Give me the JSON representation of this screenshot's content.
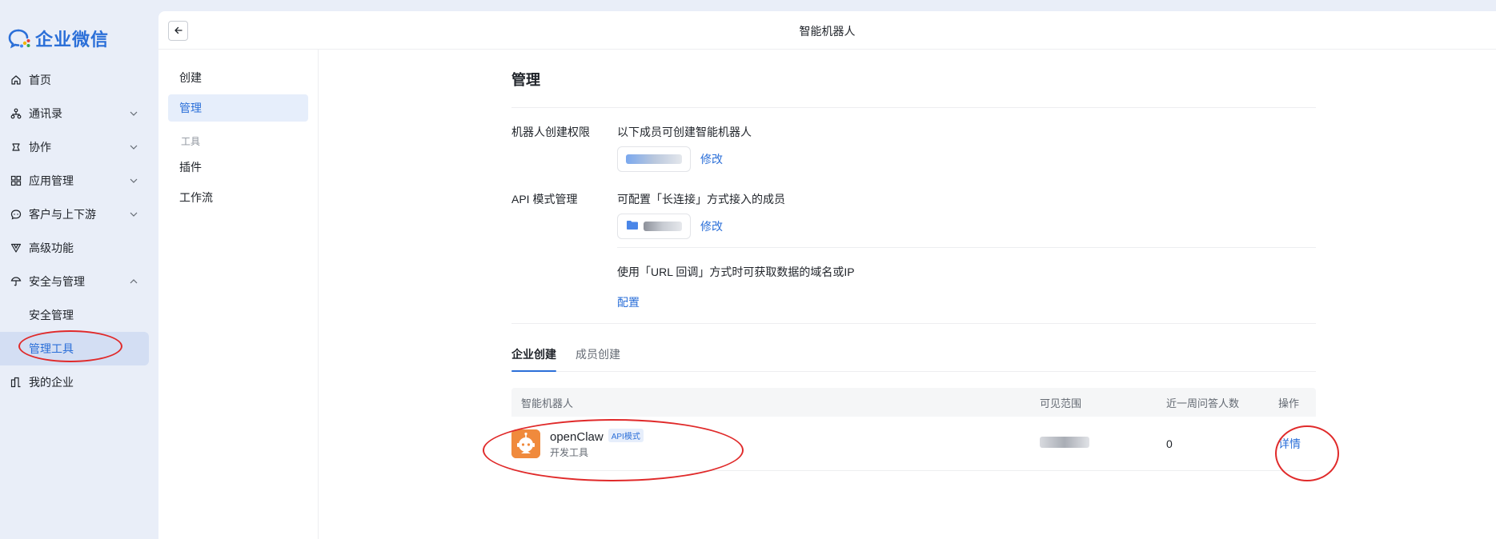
{
  "app": {
    "logo_text": "企业微信"
  },
  "sidebar": {
    "items": [
      {
        "label": "首页",
        "icon": "home-icon"
      },
      {
        "label": "通讯录",
        "icon": "contacts-icon"
      },
      {
        "label": "协作",
        "icon": "collaboration-icon"
      },
      {
        "label": "应用管理",
        "icon": "apps-icon"
      },
      {
        "label": "客户与上下游",
        "icon": "customer-icon"
      },
      {
        "label": "高级功能",
        "icon": "advanced-icon"
      },
      {
        "label": "安全与管理",
        "icon": "security-icon"
      },
      {
        "label": "安全管理"
      },
      {
        "label": "管理工具"
      },
      {
        "label": "我的企业",
        "icon": "enterprise-icon"
      }
    ]
  },
  "header": {
    "title": "智能机器人"
  },
  "subnav": {
    "create": "创建",
    "manage": "管理",
    "group_tools": "工具",
    "plugin": "插件",
    "workflow": "工作流"
  },
  "content": {
    "heading": "管理",
    "perm": {
      "label": "机器人创建权限",
      "desc": "以下成员可创建智能机器人",
      "edit": "修改"
    },
    "api": {
      "label": "API 模式管理",
      "desc": "可配置「长连接」方式接入的成员",
      "edit": "修改",
      "url_desc": "使用「URL 回调」方式时可获取数据的域名或IP",
      "config": "配置"
    },
    "tabs": [
      "企业创建",
      "成员创建"
    ],
    "table": {
      "headers": [
        "智能机器人",
        "可见范围",
        "近一周问答人数",
        "操作"
      ],
      "rows": [
        {
          "name": "openClaw",
          "tag": "API模式",
          "sub": "开发工具",
          "count": "0",
          "action": "详情"
        }
      ]
    }
  },
  "colors": {
    "accent": "#2b6fd8",
    "annotation": "#e02a2a",
    "bot_avatar": "#f08a3c"
  }
}
